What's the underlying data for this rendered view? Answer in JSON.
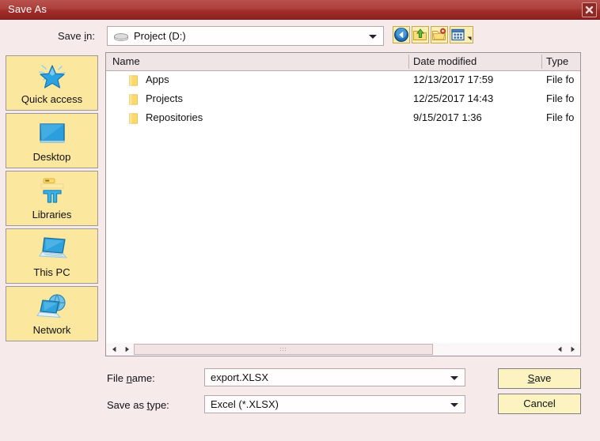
{
  "window": {
    "title": "Save As",
    "close_label": "close-icon",
    "titlebar_color": "#a12f2b",
    "background_color": "#f6eaeb"
  },
  "savein": {
    "label_pre": "Save ",
    "label_accel": "i",
    "label_post": "n:",
    "value": "Project (D:)",
    "icon": "drive-icon"
  },
  "toolbar": {
    "buttons": [
      {
        "name": "back-button",
        "icon": "back-arrow-icon",
        "tooltip": "Back"
      },
      {
        "name": "up-one-level-button",
        "icon": "up-folder-icon",
        "tooltip": "Up one level"
      },
      {
        "name": "new-folder-button",
        "icon": "new-folder-icon",
        "tooltip": "Create New Folder"
      },
      {
        "name": "views-button",
        "icon": "views-grid-icon",
        "tooltip": "Views"
      }
    ]
  },
  "sidebar": {
    "items": [
      {
        "label": "Quick access",
        "icon": "star-icon"
      },
      {
        "label": "Desktop",
        "icon": "monitor-icon"
      },
      {
        "label": "Libraries",
        "icon": "libraries-icon"
      },
      {
        "label": "This PC",
        "icon": "laptop-icon"
      },
      {
        "label": "Network",
        "icon": "network-globe-icon"
      }
    ]
  },
  "filelist": {
    "columns": [
      "Name",
      "Date modified",
      "Type"
    ],
    "rows": [
      {
        "name": "Apps",
        "date": "12/13/2017 17:59",
        "type": "File fo"
      },
      {
        "name": "Projects",
        "date": "12/25/2017 14:43",
        "type": "File fo"
      },
      {
        "name": "Repositories",
        "date": "9/15/2017 1:36",
        "type": "File fo"
      }
    ]
  },
  "form": {
    "filename_label_pre": "File ",
    "filename_label_accel": "n",
    "filename_label_post": "ame:",
    "filename_value": "export.XLSX",
    "savetype_label_pre": "Save as ",
    "savetype_label_accel": "t",
    "savetype_label_post": "ype:",
    "savetype_value": "Excel (*.XLSX)",
    "save_accel": "S",
    "save_rest": "ave",
    "cancel_label": "Cancel"
  }
}
